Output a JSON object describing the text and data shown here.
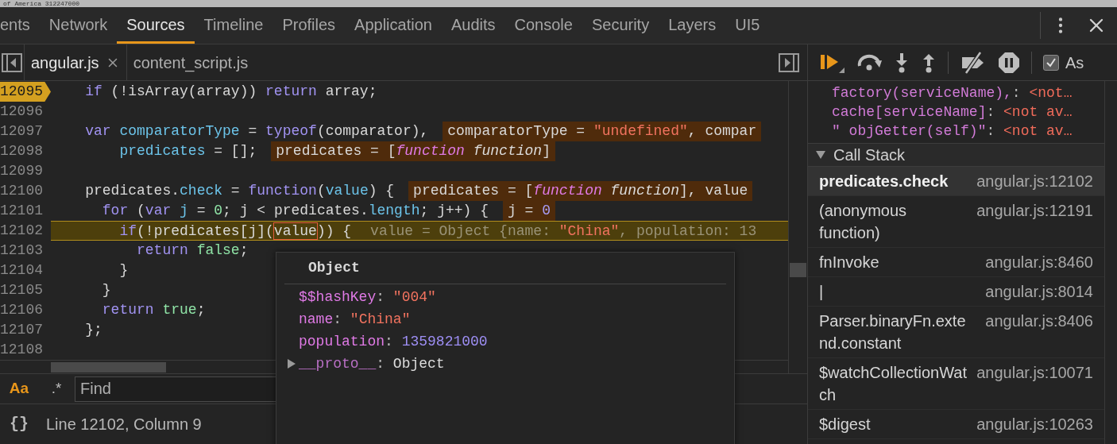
{
  "background_text": "of America 312247000",
  "panel_tabs": [
    {
      "label": "ents",
      "selected": false
    },
    {
      "label": "Network",
      "selected": false
    },
    {
      "label": "Sources",
      "selected": true
    },
    {
      "label": "Timeline",
      "selected": false
    },
    {
      "label": "Profiles",
      "selected": false
    },
    {
      "label": "Application",
      "selected": false
    },
    {
      "label": "Audits",
      "selected": false
    },
    {
      "label": "Console",
      "selected": false
    },
    {
      "label": "Security",
      "selected": false
    },
    {
      "label": "Layers",
      "selected": false
    },
    {
      "label": "UI5",
      "selected": false
    }
  ],
  "file_tabs": [
    {
      "label": "angular.js",
      "selected": true
    },
    {
      "label": "content_script.js",
      "selected": false
    }
  ],
  "code_lines": [
    {
      "number": "12095",
      "breakpoint": true,
      "current": false,
      "tokens": [
        {
          "kind": "keyword",
          "text": "    if"
        },
        {
          "kind": "plain",
          "text": " (!isArray(array)) "
        },
        {
          "kind": "keyword",
          "text": "return"
        },
        {
          "kind": "plain",
          "text": " array;"
        }
      ]
    },
    {
      "number": "12096",
      "breakpoint": false,
      "current": false
    },
    {
      "number": "12097",
      "breakpoint": false,
      "current": false,
      "tokens": [
        {
          "kind": "keyword",
          "text": "    var "
        },
        {
          "kind": "decl",
          "text": "comparatorType"
        },
        {
          "kind": "plain",
          "text": " = "
        },
        {
          "kind": "keyword",
          "text": "typeof"
        },
        {
          "kind": "plain",
          "text": "(comparator),"
        }
      ],
      "inline_value": [
        {
          "kind": "plain",
          "text": "comparatorType = "
        },
        {
          "kind": "string",
          "text": "\"undefined\""
        },
        {
          "kind": "plain",
          "text": ", compar"
        }
      ]
    },
    {
      "number": "12098",
      "breakpoint": false,
      "current": false,
      "tokens": [
        {
          "kind": "decl",
          "text": "        predicates"
        },
        {
          "kind": "plain",
          "text": " = [];"
        }
      ],
      "inline_value": [
        {
          "kind": "plain",
          "text": "predicates = ["
        },
        {
          "kind": "fn_italic",
          "text": "function "
        },
        {
          "kind": "italic",
          "text": "function"
        },
        {
          "kind": "plain",
          "text": "]"
        }
      ]
    },
    {
      "number": "12099",
      "breakpoint": false,
      "current": false
    },
    {
      "number": "12100",
      "breakpoint": false,
      "current": false,
      "tokens": [
        {
          "kind": "plain",
          "text": "    predicates."
        },
        {
          "kind": "decl",
          "text": "check"
        },
        {
          "kind": "plain",
          "text": " = "
        },
        {
          "kind": "keyword",
          "text": "function"
        },
        {
          "kind": "plain",
          "text": "("
        },
        {
          "kind": "decl",
          "text": "value"
        },
        {
          "kind": "plain",
          "text": ") {"
        }
      ],
      "inline_value": [
        {
          "kind": "plain",
          "text": "predicates = ["
        },
        {
          "kind": "fn_italic",
          "text": "function "
        },
        {
          "kind": "italic",
          "text": "function"
        },
        {
          "kind": "plain",
          "text": "], value"
        }
      ]
    },
    {
      "number": "12101",
      "breakpoint": false,
      "current": false,
      "tokens": [
        {
          "kind": "keyword",
          "text": "      for"
        },
        {
          "kind": "plain",
          "text": " ("
        },
        {
          "kind": "keyword",
          "text": "var "
        },
        {
          "kind": "decl",
          "text": "j"
        },
        {
          "kind": "plain",
          "text": " = "
        },
        {
          "kind": "literal",
          "text": "0"
        },
        {
          "kind": "plain",
          "text": "; j < predicates."
        },
        {
          "kind": "decl",
          "text": "length"
        },
        {
          "kind": "plain",
          "text": "; j++) {"
        }
      ],
      "inline_value": [
        {
          "kind": "plain",
          "text": "j = "
        },
        {
          "kind": "number",
          "text": "0"
        }
      ]
    },
    {
      "number": "12102",
      "breakpoint": false,
      "current": true,
      "tokens": [
        {
          "kind": "keyword",
          "text": "        if"
        },
        {
          "kind": "plain",
          "text": "(!predicates[j]("
        },
        {
          "kind": "marked",
          "text": "value"
        },
        {
          "kind": "plain",
          "text": ")) {"
        }
      ],
      "inline_value": [
        {
          "kind": "plain",
          "text": "value = Object {name: "
        },
        {
          "kind": "string",
          "text": "\"China\""
        },
        {
          "kind": "plain",
          "text": ", population: 13"
        }
      ]
    },
    {
      "number": "12103",
      "breakpoint": false,
      "current": false,
      "tokens": [
        {
          "kind": "keyword",
          "text": "          return "
        },
        {
          "kind": "literal",
          "text": "false"
        },
        {
          "kind": "plain",
          "text": ";"
        }
      ]
    },
    {
      "number": "12104",
      "breakpoint": false,
      "current": false,
      "tokens": [
        {
          "kind": "plain",
          "text": "        }"
        }
      ]
    },
    {
      "number": "12105",
      "breakpoint": false,
      "current": false,
      "tokens": [
        {
          "kind": "plain",
          "text": "      }"
        }
      ]
    },
    {
      "number": "12106",
      "breakpoint": false,
      "current": false,
      "tokens": [
        {
          "kind": "keyword",
          "text": "      return "
        },
        {
          "kind": "literal",
          "text": "true"
        },
        {
          "kind": "plain",
          "text": ";"
        }
      ]
    },
    {
      "number": "12107",
      "breakpoint": false,
      "current": false,
      "tokens": [
        {
          "kind": "plain",
          "text": "    };"
        }
      ]
    },
    {
      "number": "12108",
      "breakpoint": false,
      "current": false
    }
  ],
  "find_bar": {
    "case_toggle": "Aa",
    "regex_toggle": ".*",
    "placeholder": "Find"
  },
  "status_bar": {
    "pretty_print": "{}",
    "position": "Line 12102, Column 9"
  },
  "popover": {
    "title": "Object",
    "properties": [
      {
        "key": "$$hashKey",
        "separator": ":",
        "value": "\"004\"",
        "kind": "string"
      },
      {
        "key": "name",
        "separator": ":",
        "value": "\"China\"",
        "kind": "string"
      },
      {
        "key": "population",
        "separator": ":",
        "value": "1359821000",
        "kind": "number"
      },
      {
        "key": "__proto__",
        "separator": ":",
        "value": "Object",
        "kind": "object"
      }
    ]
  },
  "debugger_toolbar": [
    {
      "kind": "resume"
    },
    {
      "kind": "step_over"
    },
    {
      "kind": "step_into"
    },
    {
      "kind": "step_out"
    },
    {
      "kind": "deactivate"
    },
    {
      "kind": "pause_exceptions"
    }
  ],
  "async_checkbox": {
    "label": "As",
    "checked": true
  },
  "scope": [
    {
      "key": "factory(serviceName),",
      "separator": ":",
      "value": "<not…"
    },
    {
      "key": "cache[serviceName]",
      "separator": ":",
      "value": "<not av…"
    },
    {
      "key": "\" objGetter(self)\"",
      "separator": ":",
      "value": "<not av…"
    }
  ],
  "call_stack": {
    "title": "Call Stack",
    "expanded": true,
    "frames": [
      {
        "name": "predicates.check",
        "location": "angular.js:12102",
        "selected": true
      },
      {
        "name": "(anonymous function)",
        "location": "angular.js:12191",
        "selected": false
      },
      {
        "name": "fnInvoke",
        "location": "angular.js:8460",
        "selected": false
      },
      {
        "name": "|",
        "location": "angular.js:8014",
        "selected": false
      },
      {
        "name": "Parser.binaryFn.extend.constant",
        "location": "angular.js:8406",
        "selected": false
      },
      {
        "name": "$watchCollectionWatch",
        "location": "angular.js:10071",
        "selected": false
      },
      {
        "name": "$digest",
        "location": "angular.js:10263",
        "selected": false
      }
    ]
  }
}
